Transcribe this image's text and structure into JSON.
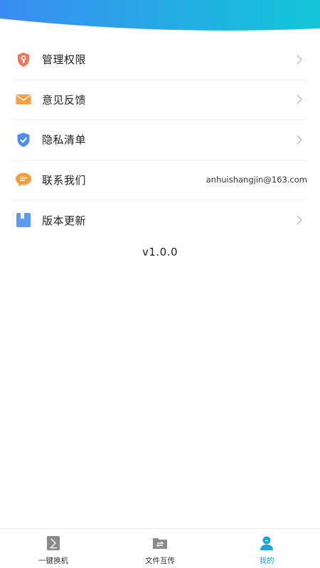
{
  "colors": {
    "header_gradient_start": "#3a8cf2",
    "header_gradient_end": "#12c6d8",
    "active_tab": "#1aa7d6",
    "inactive_tab_icon": "#8a8a8a",
    "divider": "#efefef"
  },
  "menu": {
    "items": [
      {
        "label": "管理权限",
        "icon": "key-shield-icon",
        "has_chevron": true
      },
      {
        "label": "意见反馈",
        "icon": "envelope-icon",
        "has_chevron": true
      },
      {
        "label": "隐私清单",
        "icon": "shield-check-icon",
        "has_chevron": true
      },
      {
        "label": "联系我们",
        "icon": "chat-bubble-icon",
        "value": "anhuishangjin@163.com"
      },
      {
        "label": "版本更新",
        "icon": "bookmark-icon",
        "has_chevron": true
      }
    ]
  },
  "version": "v1.0.0",
  "tabbar": {
    "tabs": [
      {
        "label": "一键换机",
        "icon": "phone-swap-icon",
        "active": false
      },
      {
        "label": "文件互传",
        "icon": "folder-transfer-icon",
        "active": false
      },
      {
        "label": "我的",
        "icon": "user-icon",
        "active": true
      }
    ]
  }
}
